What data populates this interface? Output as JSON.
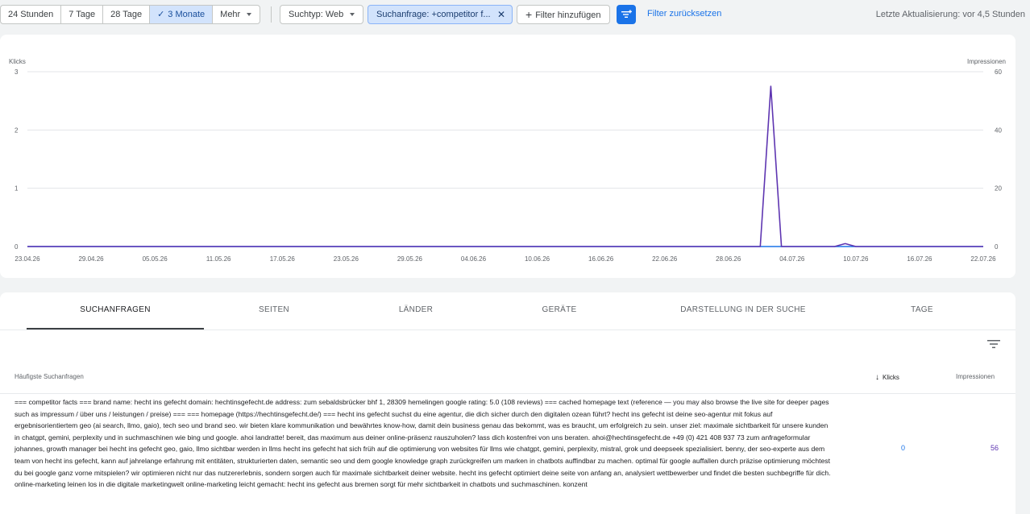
{
  "toolbar": {
    "ranges": [
      {
        "label": "24 Stunden",
        "active": false
      },
      {
        "label": "7 Tage",
        "active": false
      },
      {
        "label": "28 Tage",
        "active": false
      },
      {
        "label": "3 Monate",
        "active": true
      },
      {
        "label": "Mehr",
        "active": false
      }
    ],
    "search_type": "Suchtyp: Web",
    "query_filter": "Suchanfrage: +competitor f...",
    "add_filter": "Filter hinzufügen",
    "reset_filter": "Filter zurücksetzen",
    "last_update": "Letzte Aktualisierung: vor 4,5 Stunden"
  },
  "colors": {
    "accent": "#1a73e8",
    "clicks": "#1a73e8",
    "impressions": "#5e35b1"
  },
  "chart_data": {
    "type": "line",
    "ylabel_left": "Klicks",
    "ylabel_right": "Impressionen",
    "y_left_ticks": [
      "3",
      "2",
      "1",
      "0"
    ],
    "y_right_ticks": [
      "60",
      "40",
      "20",
      "0"
    ],
    "ylim_left": [
      0,
      3
    ],
    "ylim_right": [
      0,
      60
    ],
    "x_tick_labels": [
      "23.04.26",
      "29.04.26",
      "05.05.26",
      "11.05.26",
      "17.05.26",
      "23.05.26",
      "29.05.26",
      "04.06.26",
      "10.06.26",
      "16.06.26",
      "22.06.26",
      "28.06.26",
      "04.07.26",
      "10.07.26",
      "16.07.26",
      "22.07.26"
    ],
    "grid": true,
    "series": [
      {
        "name": "Klicks",
        "axis": "left",
        "color": "#1a73e8",
        "points": [
          [
            "23.04.26",
            0
          ],
          [
            "22.07.26",
            0
          ]
        ]
      },
      {
        "name": "Impressionen",
        "axis": "right",
        "color": "#5e35b1",
        "points": [
          [
            "23.04.26",
            0
          ],
          [
            "01.07.26",
            0
          ],
          [
            "02.07.26",
            55
          ],
          [
            "03.07.26",
            0
          ],
          [
            "08.07.26",
            0
          ],
          [
            "09.07.26",
            1
          ],
          [
            "10.07.26",
            0
          ],
          [
            "22.07.26",
            0
          ]
        ]
      }
    ]
  },
  "tabs": [
    {
      "label": "SUCHANFRAGEN",
      "active": true
    },
    {
      "label": "SEITEN",
      "active": false
    },
    {
      "label": "LÄNDER",
      "active": false
    },
    {
      "label": "GERÄTE",
      "active": false
    },
    {
      "label": "DARSTELLUNG IN DER SUCHE",
      "active": false
    },
    {
      "label": "TAGE",
      "active": false
    }
  ],
  "table": {
    "headers": {
      "query": "Häufigste Suchanfragen",
      "clicks": "Klicks",
      "impressions": "Impressionen"
    },
    "rows": [
      {
        "query": "=== competitor facts === brand name: hecht ins gefecht domain: hechtinsgefecht.de address: zum sebaldsbrücker bhf 1, 28309 hemelingen google rating: 5.0 (108 reviews) === cached homepage text (reference — you may also browse the live site for deeper pages such as impressum / über uns / leistungen / preise) === === homepage (https://hechtinsgefecht.de/) === hecht ins gefecht suchst du eine agentur, die dich sicher durch den digitalen ozean führt? hecht ins gefecht ist deine seo-agentur mit fokus auf ergebnisorientiertem geo (ai search, llmo, gaio), tech seo und brand seo. wir bieten klare kommunikation und bewährtes know-how, damit dein business genau das bekommt, was es braucht, um erfolgreich zu sein. unser ziel: maximale sichtbarkeit für unsere kunden in chatgpt, gemini, perplexity und in suchmaschinen wie bing und google. ahoi landratte! bereit, das maximum aus deiner online-präsenz rauszuholen? lass dich kostenfrei von uns beraten. ahoi@hechtinsgefecht.de +49 (0) 421 408 937 73 zum anfrageformular johannes, growth manager bei hecht ins gefecht geo, gaio, llmo sichtbar werden in llms hecht ins gefecht hat sich früh auf die optimierung von websites für llms wie chatgpt, gemini, perplexity, mistral, grok und deepseek spezialisiert. benny, der seo-experte aus dem team von hecht ins gefecht, kann auf jahrelange erfahrung mit entitäten, strukturierten daten, semantic seo und dem google knowledge graph zurückgreifen um marken in chatbots auffindbar zu machen. optimal für google auffallen durch präzise optimierung möchtest du bei google ganz vorne mitspielen? wir optimieren nicht nur das nutzererlebnis, sondern sorgen auch für maximale sichtbarkeit deiner website. hecht ins gefecht optimiert deine seite von anfang an, analysiert wettbewerber und findet die besten suchbegriffe für dich. online-marketing leinen los in die digitale marketingwelt online-marketing leicht gemacht: hecht ins gefecht aus bremen sorgt für mehr sichtbarkeit in chatbots und suchmaschinen. konzent",
        "clicks": "0",
        "impressions": "56"
      }
    ]
  }
}
